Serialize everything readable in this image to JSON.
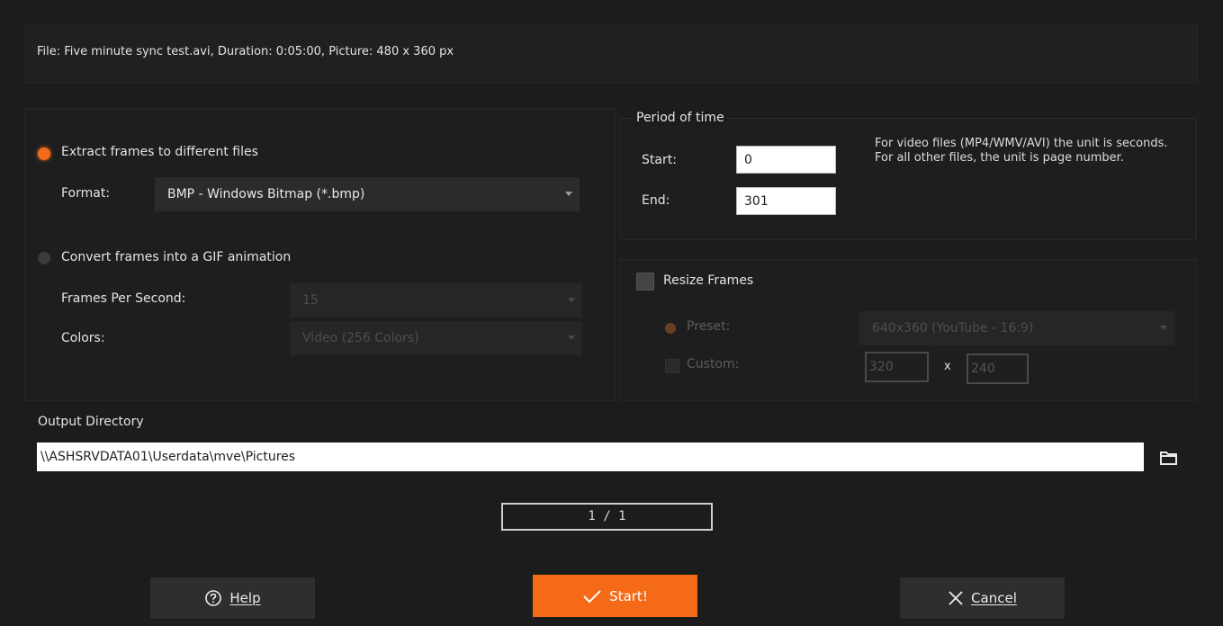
{
  "file_info": "File: Five minute sync test.avi, Duration: 0:05:00, Picture: 480 x 360 px",
  "extract": {
    "radio_label": "Extract frames to different files",
    "format_label": "Format:",
    "format_value": "BMP - Windows Bitmap (*.bmp)",
    "selected": true
  },
  "gif": {
    "radio_label": "Convert frames into a GIF animation",
    "fps_label": "Frames Per Second:",
    "fps_value": "15",
    "colors_label": "Colors:",
    "colors_value": "Video (256 Colors)",
    "selected": false
  },
  "period": {
    "title": "Period of time",
    "start_label": "Start:",
    "start_value": "0",
    "end_label": "End:",
    "end_value": "301",
    "hint": "For video files (MP4/WMV/AVI) the unit is seconds. For all other files, the unit is page number."
  },
  "resize": {
    "label": "Resize Frames",
    "checked": false,
    "preset_label": "Preset:",
    "preset_value": "640x360 (YouTube - 16:9)",
    "custom_label": "Custom:",
    "width_value": "320",
    "x_label": "x",
    "height_value": "240"
  },
  "output": {
    "label": "Output Directory",
    "path": "\\\\ASHSRVDATA01\\Userdata\\mve\\Pictures"
  },
  "progress": {
    "text": "1 / 1"
  },
  "buttons": {
    "help_label": "Help",
    "start_label": "Start!",
    "cancel_label": "Cancel"
  },
  "colors": {
    "accent": "#f46a16",
    "background": "#1c1c1c"
  },
  "icons": {
    "help": "help-circle-icon",
    "start": "checkmark-icon",
    "cancel": "close-icon",
    "browse": "folder-icon",
    "dropdown": "chevron-down-icon"
  }
}
